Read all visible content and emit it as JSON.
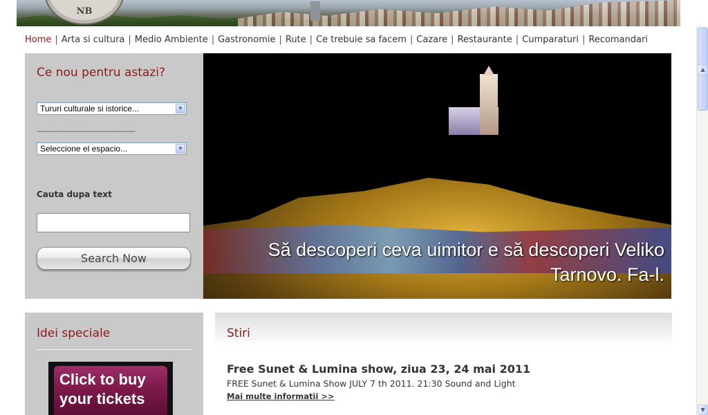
{
  "header": {
    "logo_text": "NB"
  },
  "nav": {
    "items": [
      {
        "label": "Home",
        "active": true
      },
      {
        "label": "Arta si cultura"
      },
      {
        "label": "Medio Ambiente"
      },
      {
        "label": "Gastronomie"
      },
      {
        "label": "Rute"
      },
      {
        "label": "Ce trebuie sa facem"
      },
      {
        "label": "Cazare"
      },
      {
        "label": "Restaurante"
      },
      {
        "label": "Cumparaturi"
      },
      {
        "label": "Recomandari"
      }
    ],
    "separator": "|"
  },
  "search_panel": {
    "title": "Ce nou pentru astazi?",
    "select_1": "Tururi culturale si istorice...",
    "divider": "-----------------------------------------",
    "select_2": "Seleccione el espacio...",
    "search_label": "Cauta dupa text",
    "search_value": "",
    "search_button": "Search Now"
  },
  "hero": {
    "caption": "Să descoperi ceva uimitor e să descoperi Veliko Tarnovo. Fa-l."
  },
  "idei_panel": {
    "title": "Idei speciale",
    "tickets_banner": "Click to buy your tickets"
  },
  "news": {
    "title": "Stiri",
    "items": [
      {
        "headline": "Free Sunet & Lumina show, ziua 23, 24 mai 2011",
        "text": "FREE Sunet & Lumina Show JULY 7 th 2011. 21:30 Sound and Light",
        "link": "Mai multe informatii >>"
      }
    ]
  },
  "colors": {
    "accent": "#8b1a1a",
    "panel_bg": "#c9c9c9"
  }
}
